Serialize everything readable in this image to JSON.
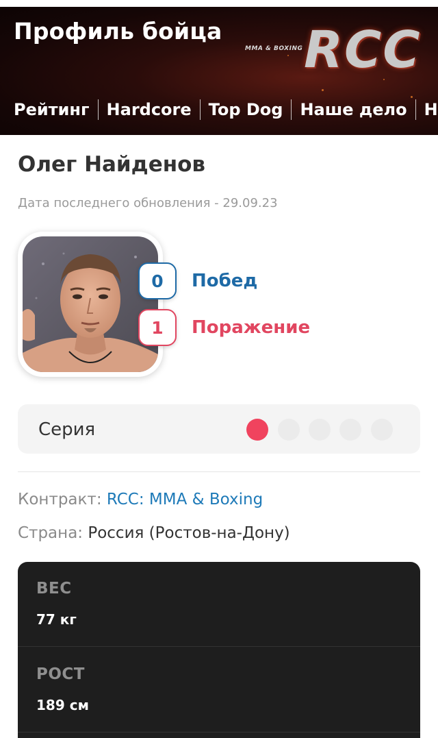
{
  "header": {
    "title": "Профиль бойца",
    "logo_text": "RCC",
    "logo_subtext": "MMA & BOXING",
    "nav": [
      "Рейтинг",
      "Hardcore",
      "Top Dog",
      "Наше дело",
      "Hardcore"
    ]
  },
  "fighter": {
    "name": "Олег Найденов",
    "updated_label": "Дата последнего обновления",
    "updated_sep": " - ",
    "updated_date": "29.09.23",
    "wins_count": "0",
    "wins_label": "Побед",
    "losses_count": "1",
    "losses_label": "Поражение"
  },
  "series": {
    "label": "Серия",
    "results": [
      "loss",
      "empty",
      "empty",
      "empty",
      "empty"
    ]
  },
  "info": {
    "contract_label": "Контракт: ",
    "contract_value": "RCC: MMA & Boxing",
    "country_label": "Страна: ",
    "country_value": "Россия (Ростов-на-Дону)"
  },
  "stats": [
    {
      "label": "ВЕС",
      "value": "77 кг"
    },
    {
      "label": "РОСТ",
      "value": "189 см"
    }
  ],
  "colors": {
    "win": "#1e6aa6",
    "loss": "#e14660",
    "link": "#1e7ab8",
    "card_dark": "#1e1e1e"
  }
}
